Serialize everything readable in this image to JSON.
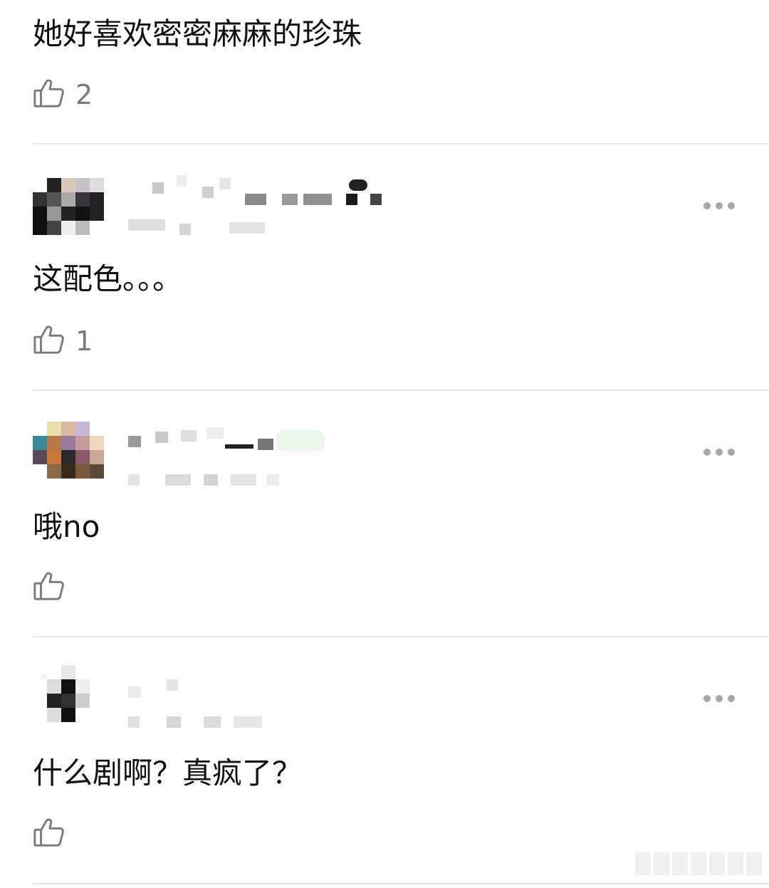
{
  "comments": [
    {
      "text": "她好喜欢密密麻麻的珍珠",
      "likes": "2"
    },
    {
      "text": "这配色。。。",
      "likes": "1",
      "badge": ""
    },
    {
      "text": "哦no",
      "likes": ""
    },
    {
      "text": "什么剧啊？真疯了？",
      "likes": ""
    }
  ],
  "icons": {
    "like": "thumbs-up-icon",
    "more": "more-dots-icon"
  },
  "colors": {
    "divider": "#e6e6e6",
    "icon_gray": "#7a7a7a",
    "badge_green": "#1aa64a"
  }
}
